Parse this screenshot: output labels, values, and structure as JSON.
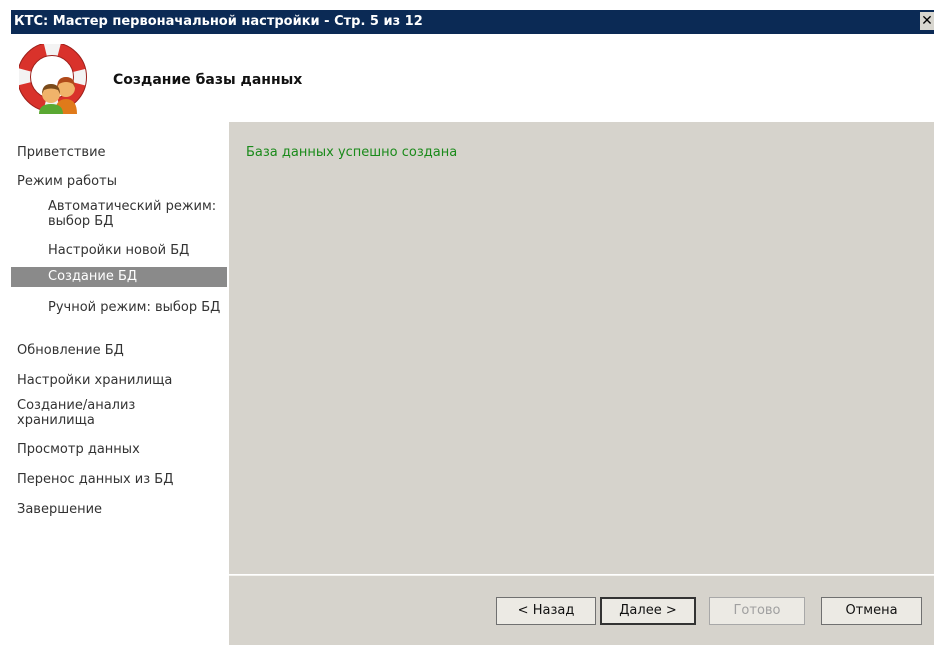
{
  "window": {
    "title": "КТС: Мастер первоначальной настройки - Стр. 5 из 12",
    "close_glyph": "✕"
  },
  "header": {
    "heading": "Создание базы данных"
  },
  "nav": {
    "items": [
      {
        "label": "Приветствие",
        "level": "top"
      },
      {
        "label": "Режим работы",
        "level": "top"
      },
      {
        "label": "Автоматический режим: выбор БД",
        "level": "sub"
      },
      {
        "label": "Настройки новой БД",
        "level": "sub"
      },
      {
        "label": "Создание БД",
        "level": "sub",
        "active": true
      },
      {
        "label": "Ручной режим: выбор БД",
        "level": "sub"
      },
      {
        "label": "Обновление БД",
        "level": "top"
      },
      {
        "label": "Настройки хранилища",
        "level": "top"
      },
      {
        "label": "Создание/анализ хранилища",
        "level": "top"
      },
      {
        "label": "Просмотр данных",
        "level": "top"
      },
      {
        "label": "Перенос данных из БД",
        "level": "top"
      },
      {
        "label": "Завершение",
        "level": "top"
      }
    ]
  },
  "content": {
    "status": "База данных успешно создана",
    "status_color": "#1a8a1a"
  },
  "buttons": {
    "back": "< Назад",
    "next": "Далее >",
    "finish": "Готово",
    "cancel": "Отмена"
  },
  "colors": {
    "titlebar": "#0b2a55",
    "panel": "#d6d3cc",
    "nav_active": "#8a8a8a"
  }
}
